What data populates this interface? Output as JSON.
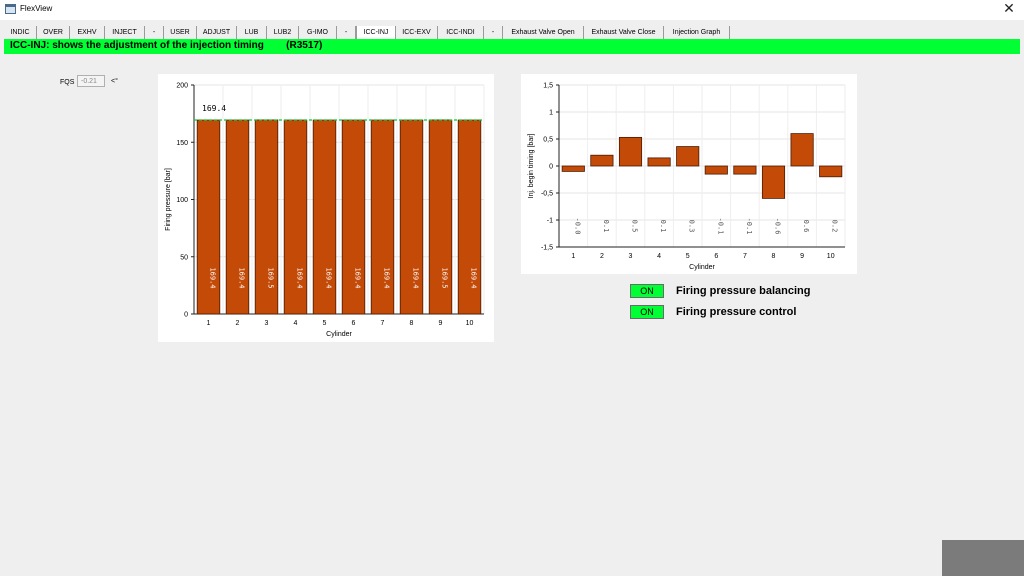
{
  "window": {
    "title": "FlexView",
    "close_icon": "close-icon"
  },
  "tabs": [
    {
      "label": "INDIC"
    },
    {
      "label": "OVER"
    },
    {
      "label": "EXHV"
    },
    {
      "label": "INJECT"
    },
    {
      "label": "-"
    },
    {
      "label": "USER"
    },
    {
      "label": "ADJUST"
    },
    {
      "label": "LUB"
    },
    {
      "label": "LUB2"
    },
    {
      "label": "G-IMO"
    },
    {
      "label": "-"
    },
    {
      "label": "ICC-INJ",
      "active": true
    },
    {
      "label": "ICC-EXV"
    },
    {
      "label": "ICC-INDI"
    },
    {
      "label": "-"
    },
    {
      "label": "Exhaust Valve Open"
    },
    {
      "label": "Exhaust Valve Close"
    },
    {
      "label": "Injection Graph"
    }
  ],
  "banner": {
    "title": "ICC-INJ: shows the adjustment of the injection timing",
    "code": "(R3517)",
    "color": "#00ff33"
  },
  "fqs": {
    "label": "FQS",
    "value": "-0.21",
    "unit": "<°"
  },
  "status": [
    {
      "badge": "ON",
      "label": "Firing pressure balancing"
    },
    {
      "badge": "ON",
      "label": "Firing pressure control"
    }
  ],
  "chart_data": [
    {
      "type": "bar",
      "title": "",
      "xlabel": "Cylinder",
      "ylabel": "Firing pressure [bar]",
      "ylim": [
        0,
        200
      ],
      "yticks": [
        0,
        50,
        100,
        150,
        200
      ],
      "categories": [
        "1",
        "2",
        "3",
        "4",
        "5",
        "6",
        "7",
        "8",
        "9",
        "10"
      ],
      "values": [
        169.4,
        169.4,
        169.5,
        169.4,
        169.4,
        169.4,
        169.4,
        169.4,
        169.5,
        169.4
      ],
      "labels": [
        "169.4",
        "169.4",
        "169.5",
        "169.4",
        "169.4",
        "169.4",
        "169.4",
        "169.4",
        "169.5",
        "169.4"
      ],
      "reference": {
        "value": 169.4,
        "label": "169.4"
      },
      "bar_color": "#c44a08",
      "grid": true
    },
    {
      "type": "bar",
      "title": "",
      "xlabel": "Cylinder",
      "ylabel": "Inj. begin timing [bar]",
      "ylim": [
        -1.5,
        1.5
      ],
      "yticks": [
        -1.5,
        -1,
        -0.5,
        0,
        0.5,
        1,
        1.5
      ],
      "ytick_labels": [
        "-1,5",
        "-1",
        "-0,5",
        "0",
        "0,5",
        "1",
        "1,5"
      ],
      "categories": [
        "1",
        "2",
        "3",
        "4",
        "5",
        "6",
        "7",
        "8",
        "9",
        "10"
      ],
      "values": [
        -0.1,
        0.2,
        0.53,
        0.15,
        0.36,
        -0.15,
        -0.15,
        -0.6,
        0.6,
        -0.2
      ],
      "labels": [
        "-0.0",
        "0.1",
        "0.5",
        "0.1",
        "0.3",
        "-0.1",
        "-0.1",
        "-0.6",
        "0.6",
        "0.2"
      ],
      "bar_color": "#c44a08",
      "grid": true
    }
  ]
}
